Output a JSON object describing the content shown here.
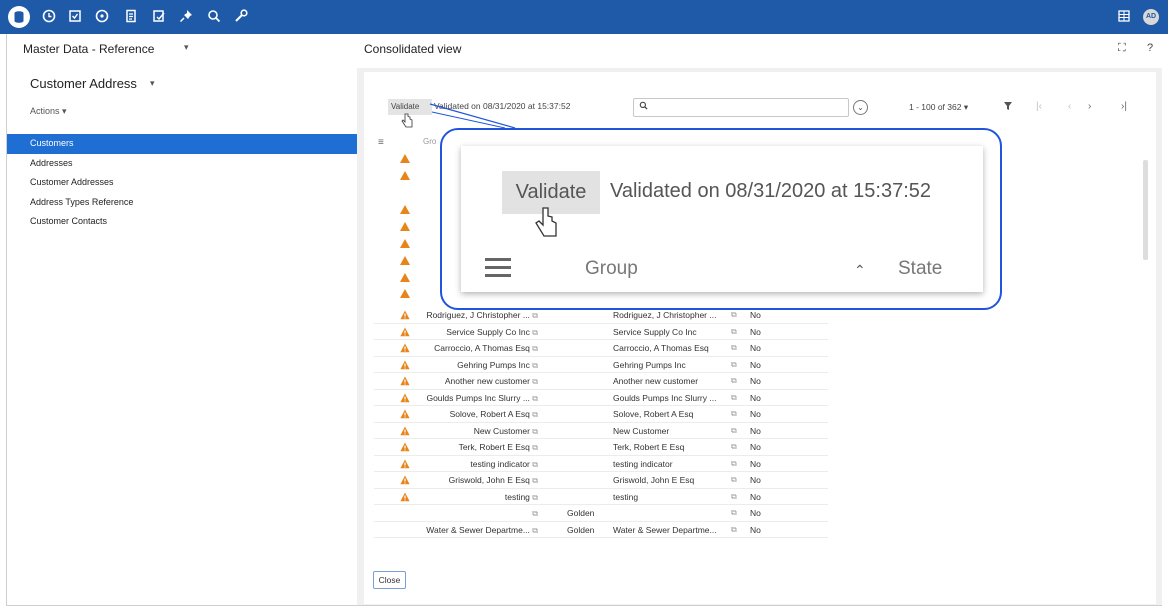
{
  "colors": {
    "topbar": "#1e5aa8",
    "active_nav": "#1f6ed4",
    "warning": "#e8851a",
    "callout_border": "#2255dd"
  },
  "topbar": {
    "icons": [
      "database-icon",
      "clock-icon",
      "checklist-icon",
      "dashboard-icon",
      "document-icon",
      "edit-check-icon",
      "pin-icon",
      "search-icon",
      "wrench-icon"
    ],
    "right_icons": [
      "table-icon"
    ],
    "avatar": "AD"
  },
  "left": {
    "title": "Master Data - Reference",
    "entity": "Customer Address",
    "actions": "Actions ▾",
    "nav": [
      "Customers",
      "Addresses",
      "Customer Addresses",
      "Address Types Reference",
      "Customer Contacts"
    ],
    "active_index": 0
  },
  "right": {
    "title": "Consolidated view",
    "validate": "Validate",
    "validated_text": "Validated on 08/31/2020 at 15:37:52",
    "pager": "1 - 100 of 362 ▾",
    "group_label": "Group",
    "state_label": "State",
    "close": "Close"
  },
  "rows": [
    {
      "warn": true,
      "c1": "Rodriguez, J Christopher ...",
      "c2": "",
      "c3": "Rodriguez, J Christopher ...",
      "c4": "No"
    },
    {
      "warn": true,
      "c1": "Service Supply Co Inc",
      "c2": "",
      "c3": "Service Supply Co Inc",
      "c4": "No"
    },
    {
      "warn": true,
      "c1": "Carroccio, A Thomas Esq",
      "c2": "",
      "c3": "Carroccio, A Thomas Esq",
      "c4": "No"
    },
    {
      "warn": true,
      "c1": "Gehring Pumps Inc",
      "c2": "",
      "c3": "Gehring Pumps Inc",
      "c4": "No"
    },
    {
      "warn": true,
      "c1": "Another new customer",
      "c2": "",
      "c3": "Another new customer",
      "c4": "No"
    },
    {
      "warn": true,
      "c1": "Goulds Pumps Inc Slurry ...",
      "c2": "",
      "c3": "Goulds Pumps Inc Slurry ...",
      "c4": "No"
    },
    {
      "warn": true,
      "c1": "Solove, Robert A Esq",
      "c2": "",
      "c3": "Solove, Robert A Esq",
      "c4": "No"
    },
    {
      "warn": true,
      "c1": "New Customer",
      "c2": "",
      "c3": "New Customer",
      "c4": "No"
    },
    {
      "warn": true,
      "c1": "Terk, Robert E Esq",
      "c2": "",
      "c3": "Terk, Robert E Esq",
      "c4": "No"
    },
    {
      "warn": true,
      "c1": "testing indicator",
      "c2": "",
      "c3": "testing indicator",
      "c4": "No"
    },
    {
      "warn": true,
      "c1": "Griswold, John E Esq",
      "c2": "",
      "c3": "Griswold, John E Esq",
      "c4": "No"
    },
    {
      "warn": true,
      "c1": "testing",
      "c2": "",
      "c3": "testing",
      "c4": "No"
    },
    {
      "warn": false,
      "c1": "",
      "c2": "Golden",
      "c3": "",
      "c4": "No"
    },
    {
      "warn": false,
      "c1": "Water & Sewer Departme...",
      "c2": "Golden",
      "c3": "Water & Sewer Departme...",
      "c4": "No"
    }
  ]
}
